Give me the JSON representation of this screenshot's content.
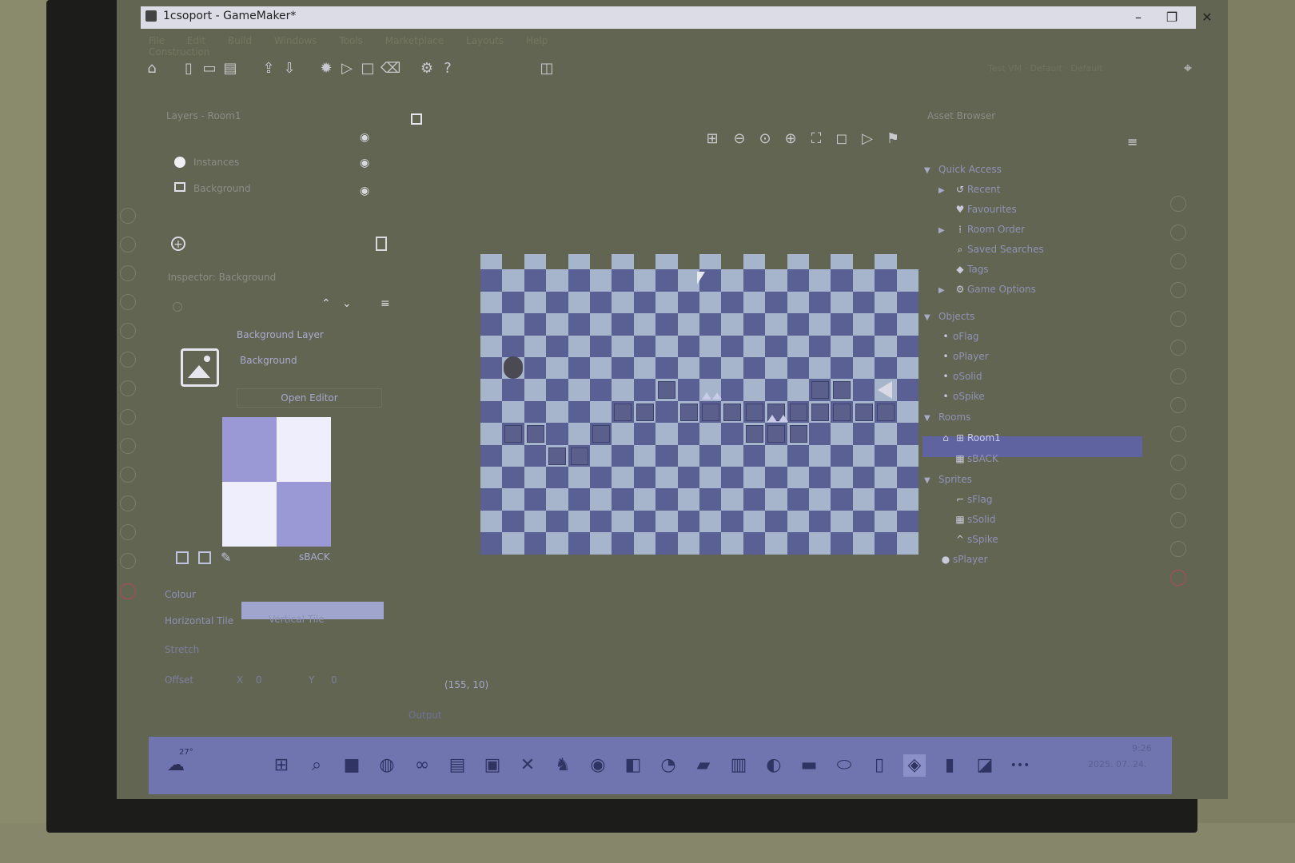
{
  "window": {
    "title": "1csoport - GameMaker*",
    "minimize": "–",
    "restore": "❐",
    "close": "✕"
  },
  "menu": {
    "items": [
      "File",
      "Edit",
      "Build",
      "Windows",
      "Tools",
      "Marketplace",
      "Layouts",
      "Help",
      "Construction"
    ]
  },
  "toolbar": {
    "icons": [
      "home-icon",
      "new-file-icon",
      "open-folder-icon",
      "save-icon",
      "export-icon",
      "import-icon",
      "debug-icon",
      "run-icon",
      "stop-icon",
      "clean-icon",
      "settings-icon",
      "help-icon",
      "game-icon"
    ],
    "right_text": "Test  VM  ·  Default  ·  Default",
    "target_icon": "target-icon"
  },
  "layers": {
    "title": "Layers - Room1",
    "items": [
      {
        "label": "Instances",
        "icon": "circle-icon"
      },
      {
        "label": "Background",
        "icon": "image-icon"
      }
    ]
  },
  "inspector": {
    "title": "Inspector: Background",
    "layer_type": "Background Layer",
    "layer_name": "Background",
    "open_editor": "Open Editor",
    "sprite_name": "sBACK",
    "colour_label": "Colour",
    "horizontal_tile": "Horizontal Tile",
    "vertical_tile": "Vertical Tile",
    "stretch": "Stretch",
    "offset": "Offset",
    "offset_x_label": "X",
    "offset_x": "0",
    "offset_y_label": "Y",
    "offset_y": "0"
  },
  "colors": {
    "tile_light": "#a6b4cc",
    "tile_dark": "#5b6094",
    "preview_dark": "#9b98d6",
    "preview_light": "#eeeefc",
    "accent": "#5f63a0"
  },
  "room": {
    "coord_readout": "(155, 10)",
    "output_label": "Output"
  },
  "asset_browser": {
    "title": "Asset Browser",
    "quick_access": "Quick Access",
    "quick_items": [
      "Recent",
      "Favourites",
      "Room Order",
      "Saved Searches",
      "Tags",
      "Game Options"
    ],
    "objects_group": "Objects",
    "objects": [
      "oFlag",
      "oPlayer",
      "oSolid",
      "oSpike"
    ],
    "rooms_group": "Rooms",
    "rooms": [
      "Room1",
      "sBACK"
    ],
    "sprites_group": "Sprites",
    "sprites": [
      "sFlag",
      "sSolid",
      "sSpike",
      "sPlayer"
    ]
  },
  "taskbar": {
    "weather": "27°",
    "time": "9:26",
    "date": "2025. 07. 24.",
    "more": "•••"
  }
}
